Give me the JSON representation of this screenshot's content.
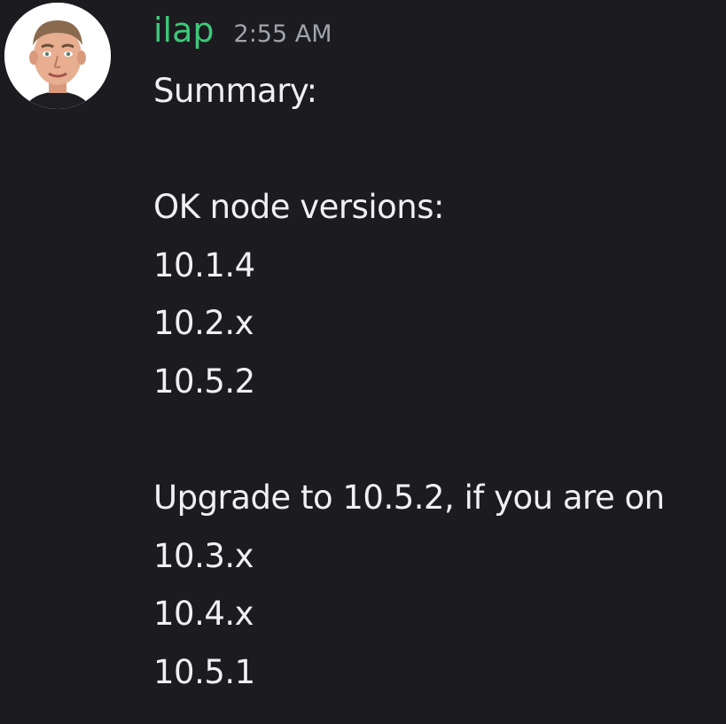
{
  "message": {
    "author": "ilap",
    "timestamp": "2:55 AM",
    "author_color": "#3ec87a",
    "avatar_icon": "user-avatar-cartoon-face",
    "lines": [
      "Summary:",
      "",
      "OK node versions:",
      "10.1.4",
      "10.2.x",
      "10.5.2",
      "",
      "Upgrade to 10.5.2, if you are on",
      "10.3.x",
      "10.4.x",
      "10.5.1"
    ]
  }
}
